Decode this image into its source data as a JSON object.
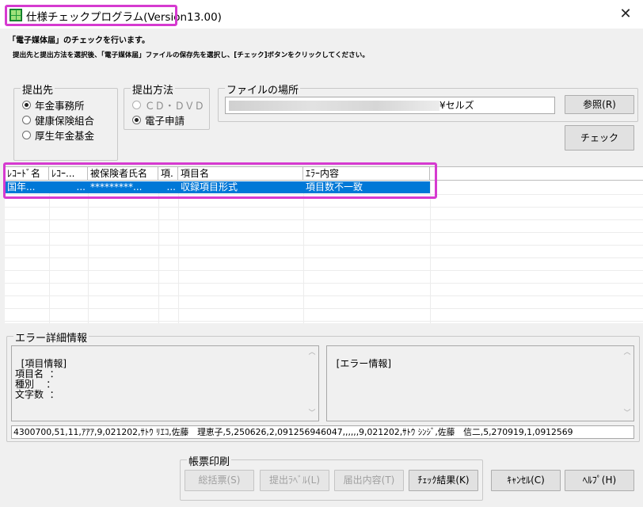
{
  "window": {
    "title": "仕様チェックプログラム(Version13.00)",
    "close_glyph": "✕"
  },
  "instructions": {
    "line1": "「電子媒体届」のチェックを行います。",
    "line2": "提出先と提出方法を選択後、「電子媒体届」ファイルの保存先を選択し、[チェック]ボタンをクリックしてください。"
  },
  "destination": {
    "label": "提出先",
    "options": [
      {
        "label": "年金事務所",
        "selected": true
      },
      {
        "label": "健康保険組合",
        "selected": false
      },
      {
        "label": "厚生年金基金",
        "selected": false
      }
    ]
  },
  "method": {
    "label": "提出方法",
    "options": [
      {
        "label": "ＣＤ・ＤＶＤ",
        "selected": false,
        "enabled": false
      },
      {
        "label": "電子申請",
        "selected": true,
        "enabled": true
      }
    ]
  },
  "file_location": {
    "label": "ファイルの場所",
    "path_visible": "¥セルズ",
    "browse_label": "参照(R)"
  },
  "check_button": "チェック",
  "grid": {
    "columns": [
      "ﾚｺｰﾄﾞ名",
      "ﾚｺｰ...",
      "被保険者氏名",
      "項.",
      "項目名",
      "ｴﾗｰ内容"
    ],
    "rows": [
      {
        "cells": [
          "国年...",
          "...",
          "*********...",
          "...",
          "収録項目形式",
          "項目数不一致"
        ],
        "selected": true
      }
    ]
  },
  "error_detail": {
    "label": "エラー詳細情報",
    "item_info": "[項目情報]\n項目名  ：\n種別    ：\n文字数  ：",
    "error_info": "[エラー情報]",
    "record_line": "4300700,51,11,ｱｱｱ,9,021202,ｻﾄｳ ﾘｴｺ,佐藤　理恵子,5,250626,2,091256946047,,,,,,9,021202,ｻﾄｳ ｼﾝｼﾞ,佐藤　信二,5,270919,1,0912569"
  },
  "print": {
    "label": "帳票印刷",
    "buttons": [
      {
        "label": "総括票(S)",
        "enabled": false
      },
      {
        "label": "提出ﾗﾍﾞﾙ(L)",
        "enabled": false
      },
      {
        "label": "届出内容(T)",
        "enabled": false
      },
      {
        "label": "ﾁｪｯｸ結果(K)",
        "enabled": true
      }
    ]
  },
  "footer": {
    "cancel_label": "ｷｬﾝｾﾙ(C)",
    "help_label": "ﾍﾙﾌﾟ(H)"
  },
  "colors": {
    "selection": "#0078d7",
    "highlight_annotation": "#d63ad0"
  }
}
